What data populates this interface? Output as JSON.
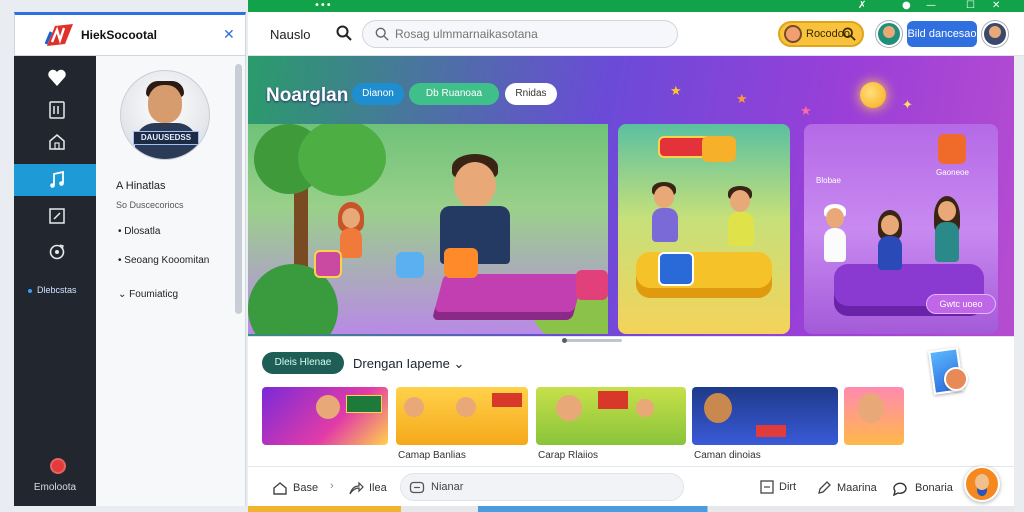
{
  "sidebar": {
    "app_name": "HiekSocootal",
    "rail": {
      "small_label": "Dlebcstas",
      "bottom_label": "Emoloota"
    },
    "panel": {
      "profile_tag": "DAUUSEDSS",
      "items": [
        {
          "label": "A Hinatlas",
          "style": "strong"
        },
        {
          "label": "So Duscecoriocs",
          "style": "muted"
        },
        {
          "label": "Dlosatla",
          "style": "normal"
        },
        {
          "label": "Seoang Kooomitan",
          "style": "normal"
        },
        {
          "label": "Foumiaticg",
          "style": "normal"
        }
      ]
    }
  },
  "topbar": {
    "title": "Nauslo",
    "search_placeholder": "Rosag ulmmarnaikasotana",
    "yellow_pill_label": "Rocodoo",
    "blue_button_label": "Bild dancesao"
  },
  "hero": {
    "title": "Noarglan",
    "chips": [
      "Dianon",
      "Db Ruanoaa",
      "Rnidas"
    ],
    "side_pill": "Gwtc uoeo",
    "scene_labels": {
      "s1_sign": "",
      "s3_caption1": "Blobae",
      "s3_caption2": "Gaoneoe"
    }
  },
  "section": {
    "chip_label": "Dleis Hlenae",
    "title": "Drengan Iapeme",
    "cards": [
      {
        "caption": "",
        "theme": "purple"
      },
      {
        "caption": "Camap Banlias",
        "theme": "orange"
      },
      {
        "caption": "Carap Rlaiios",
        "theme": "green"
      },
      {
        "caption": "Caman dinoias",
        "theme": "blue"
      },
      {
        "caption": "",
        "theme": "pink"
      }
    ]
  },
  "bottombar": {
    "home_label": "Base",
    "share_label": "Ilea",
    "input_label": "Nianar",
    "doc_label": "Dirt",
    "pen_label": "Maarina",
    "chat_label": "Bonaria"
  },
  "colors": {
    "accent_green": "#12a34a",
    "brand_blue": "#2f6fe0",
    "rail_active": "#1e9ad6",
    "rail_bg": "#22272f"
  }
}
